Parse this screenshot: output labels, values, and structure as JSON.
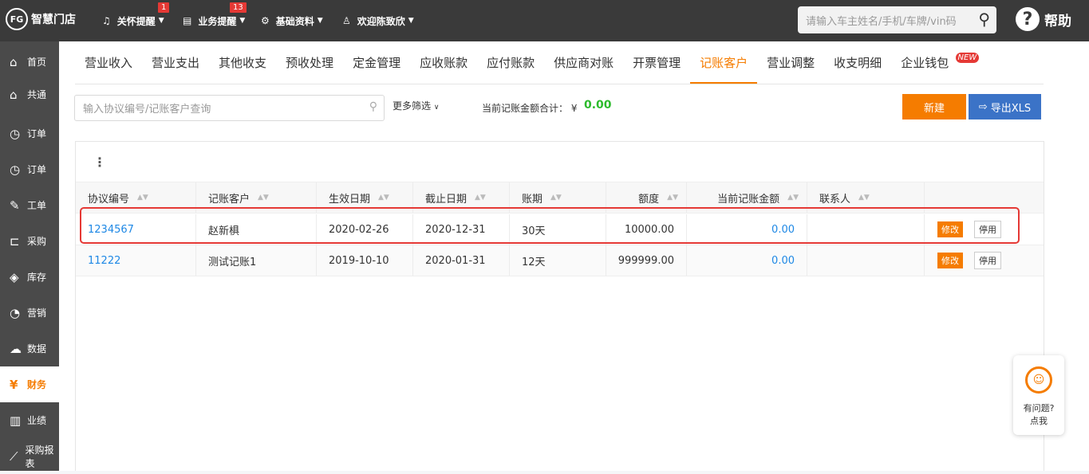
{
  "topbar": {
    "logo_mark": "FG",
    "app_name": "智慧门店",
    "nav": [
      {
        "label": "关怀提醒",
        "badge": "1",
        "icon": "bell-icon"
      },
      {
        "label": "业务提醒",
        "badge": "13",
        "icon": "document-icon"
      },
      {
        "label": "基础资料",
        "icon": "gear-icon"
      },
      {
        "label": "欢迎陈致欣",
        "icon": "user-icon"
      }
    ],
    "search_placeholder": "请输入车主姓名/手机/车牌/vin码",
    "help_label": "帮助"
  },
  "sidebar": {
    "items": [
      {
        "label": "首页",
        "icon": "home-icon"
      },
      {
        "label": "共通",
        "icon": "house-icon"
      },
      {
        "label": "订单",
        "icon": "history-icon"
      },
      {
        "label": "订单",
        "icon": "history-icon"
      },
      {
        "label": "工单",
        "icon": "wrench-icon"
      },
      {
        "label": "采购",
        "icon": "cart-icon"
      },
      {
        "label": "库存",
        "icon": "box-icon"
      },
      {
        "label": "营销",
        "icon": "pie-icon"
      },
      {
        "label": "数据",
        "icon": "cloud-icon"
      },
      {
        "label": "财务",
        "icon": "yen-icon"
      },
      {
        "label": "业绩",
        "icon": "bar-chart-icon"
      },
      {
        "label": "采购报表",
        "icon": "line-chart-icon"
      }
    ],
    "active_index": 9
  },
  "tabs": [
    "营业收入",
    "营业支出",
    "其他收支",
    "预收处理",
    "定金管理",
    "应收账款",
    "应付账款",
    "供应商对账",
    "开票管理",
    "记账客户",
    "营业调整",
    "收支明细",
    "企业钱包"
  ],
  "active_tab": 9,
  "new_badge": "NEW",
  "filter": {
    "placeholder": "输入协议编号/记账客户查询",
    "more_filter": "更多筛选",
    "sum_label": "当前记账金额合计：  ¥",
    "sum_value": "0.00"
  },
  "buttons": {
    "new": "新建",
    "export": "导出XLS"
  },
  "table": {
    "kebab": "⋮",
    "columns": [
      "协议编号",
      "记账客户",
      "生效日期",
      "截止日期",
      "账期",
      "额度",
      "当前记账金额",
      "联系人"
    ],
    "rows": [
      {
        "id": "1234567",
        "customer": "赵新椇",
        "start": "2020-02-26",
        "end": "2020-12-31",
        "term": "30天",
        "limit": "10000.00",
        "current": "0.00",
        "contact": "",
        "edit": "修改",
        "stop": "停用"
      },
      {
        "id": "11222",
        "customer": "测试记账1",
        "start": "2019-10-10",
        "end": "2020-01-31",
        "term": "12天",
        "limit": "999999.00",
        "current": "0.00",
        "contact": "",
        "edit": "修改",
        "stop": "停用"
      }
    ]
  },
  "help_widget": {
    "line1": "有问题?",
    "line2": "点我"
  }
}
